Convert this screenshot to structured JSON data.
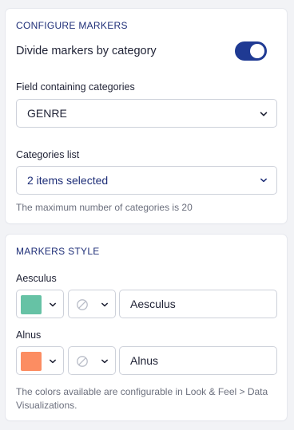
{
  "configure": {
    "title": "CONFIGURE MARKERS",
    "divide_label": "Divide markers by category",
    "divide_enabled": true,
    "field_label": "Field containing categories",
    "field_value": "GENRE",
    "categories_label": "Categories list",
    "categories_value": "2 items selected",
    "categories_hint": "The maximum number of categories is 20"
  },
  "style": {
    "title": "MARKERS STYLE",
    "markers": [
      {
        "label": "Aesculus",
        "color": "#66c2a5",
        "name": "Aesculus"
      },
      {
        "label": "Alnus",
        "color": "#fc8d62",
        "name": "Alnus"
      }
    ],
    "footer_hint": "The colors available are configurable in Look & Feel > Data Visualizations."
  },
  "colors": {
    "accent": "#1f3a93",
    "section_title": "#1f2f78"
  }
}
